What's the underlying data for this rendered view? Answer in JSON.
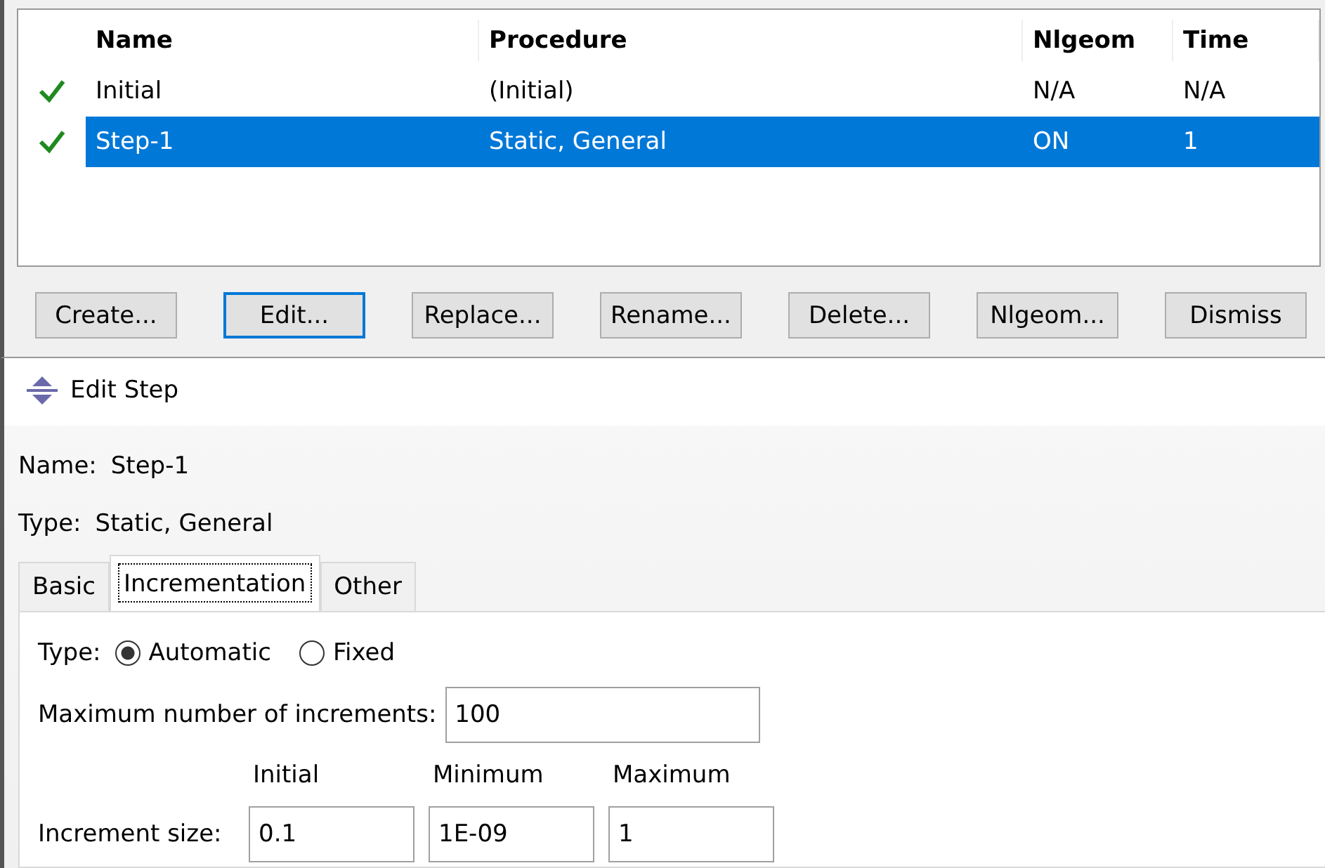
{
  "step_manager": {
    "columns": [
      "Name",
      "Procedure",
      "Nlgeom",
      "Time"
    ],
    "rows": [
      {
        "checked": true,
        "selected": false,
        "cells": [
          "Initial",
          "(Initial)",
          "N/A",
          "N/A"
        ]
      },
      {
        "checked": true,
        "selected": true,
        "cells": [
          "Step-1",
          "Static, General",
          "ON",
          "1"
        ]
      }
    ],
    "buttons": [
      {
        "label": "Create...",
        "focused": false
      },
      {
        "label": "Edit...",
        "focused": true
      },
      {
        "label": "Replace...",
        "focused": false
      },
      {
        "label": "Rename...",
        "focused": false
      },
      {
        "label": "Delete...",
        "focused": false
      },
      {
        "label": "Nlgeom...",
        "focused": false
      },
      {
        "label": "Dismiss",
        "focused": false
      }
    ]
  },
  "edit_step": {
    "title": "Edit Step",
    "name_label": "Name:",
    "name_value": "Step-1",
    "type_label": "Type:",
    "type_value": "Static, General",
    "tabs": [
      {
        "label": "Basic",
        "selected": false
      },
      {
        "label": "Incrementation",
        "selected": true
      },
      {
        "label": "Other",
        "selected": false
      }
    ],
    "type_field": {
      "label": "Type:",
      "options": [
        {
          "label": "Automatic",
          "selected": true
        },
        {
          "label": "Fixed",
          "selected": false
        }
      ]
    },
    "max_increments": {
      "label": "Maximum number of increments:",
      "value": "100"
    },
    "increment_size": {
      "label": "Increment size:",
      "columns": [
        "Initial",
        "Minimum",
        "Maximum"
      ],
      "values": [
        "0.1",
        "1E-09",
        "1"
      ]
    }
  }
}
